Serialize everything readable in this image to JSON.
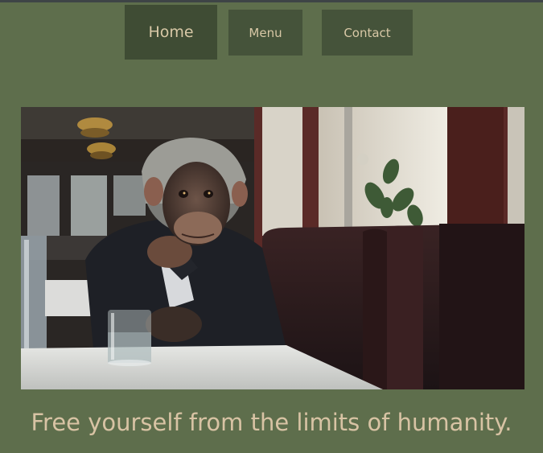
{
  "nav": {
    "items": [
      {
        "label": "Home",
        "active": true
      },
      {
        "label": "Menu",
        "active": false
      },
      {
        "label": "Contact",
        "active": false
      }
    ]
  },
  "hero": {
    "subject": "chimpanzee in a dark suit seated in a restaurant booth beside a window, glass of water on a white-clothed table"
  },
  "tagline": "Free yourself from the limits of humanity.",
  "colors": {
    "background": "#5e6e4c",
    "nav_button": "#45533a",
    "nav_button_active": "#3f4c34",
    "text_accent": "#d8c3a4"
  }
}
